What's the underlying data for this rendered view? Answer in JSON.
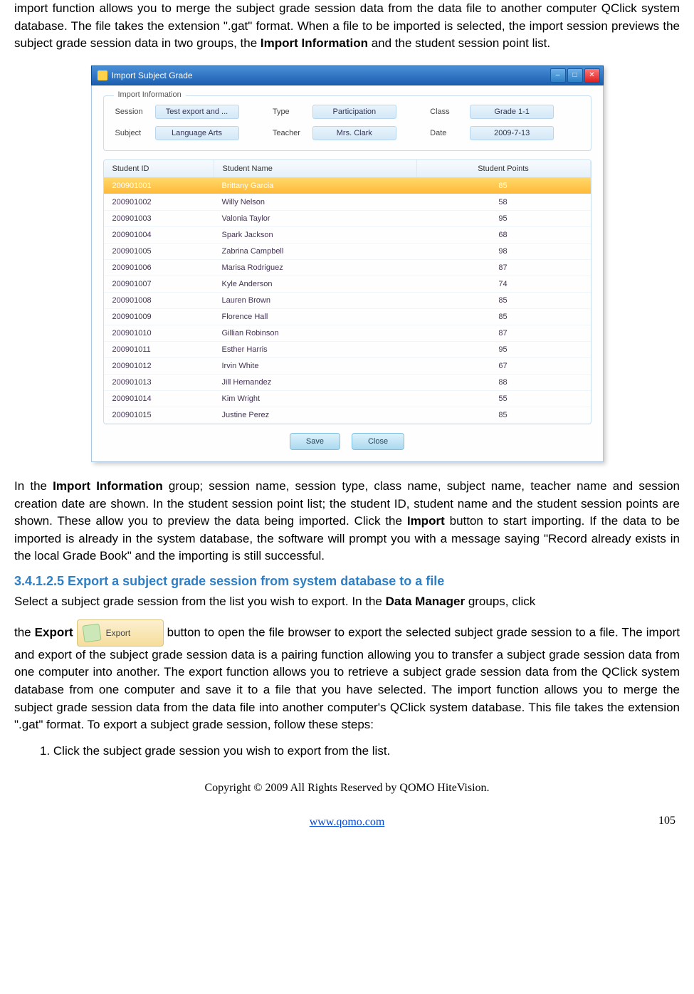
{
  "para1_part1": "import function allows you to merge the subject grade session data from the data file to another computer QClick system database. The file takes the extension \".gat\" format. When a file to be imported is selected, the import session previews the subject grade session data in two groups, the ",
  "para1_bold": "Import Information",
  "para1_part2": " and the student session point list.",
  "dialog": {
    "title": "Import Subject Grade",
    "legend": "Import Information",
    "labels": {
      "session": "Session",
      "type": "Type",
      "class": "Class",
      "subject": "Subject",
      "teacher": "Teacher",
      "date": "Date"
    },
    "values": {
      "session": "Test export and ...",
      "type": "Participation",
      "class": "Grade 1-1",
      "subject": "Language Arts",
      "teacher": "Mrs. Clark",
      "date": "2009-7-13"
    },
    "headers": {
      "id": "Student ID",
      "name": "Student Name",
      "points": "Student Points"
    },
    "rows": [
      {
        "id": "200901001",
        "name": "Brittany Garcia",
        "pts": "85",
        "sel": true
      },
      {
        "id": "200901002",
        "name": "Willy Nelson",
        "pts": "58"
      },
      {
        "id": "200901003",
        "name": "Valonia Taylor",
        "pts": "95"
      },
      {
        "id": "200901004",
        "name": "Spark Jackson",
        "pts": "68"
      },
      {
        "id": "200901005",
        "name": "Zabrina Campbell",
        "pts": "98"
      },
      {
        "id": "200901006",
        "name": "Marisa Rodriguez",
        "pts": "87"
      },
      {
        "id": "200901007",
        "name": "Kyle Anderson",
        "pts": "74"
      },
      {
        "id": "200901008",
        "name": "Lauren Brown",
        "pts": "85"
      },
      {
        "id": "200901009",
        "name": "Florence Hall",
        "pts": "85"
      },
      {
        "id": "200901010",
        "name": "Gillian Robinson",
        "pts": "87"
      },
      {
        "id": "200901011",
        "name": "Esther Harris",
        "pts": "95"
      },
      {
        "id": "200901012",
        "name": "Irvin White",
        "pts": "67"
      },
      {
        "id": "200901013",
        "name": "Jill  Hernandez",
        "pts": "88"
      },
      {
        "id": "200901014",
        "name": "Kim Wright",
        "pts": "55"
      },
      {
        "id": "200901015",
        "name": "Justine Perez",
        "pts": "85"
      }
    ],
    "save": "Save",
    "close": "Close"
  },
  "para2_a": "In the ",
  "para2_b": "Import Information",
  "para2_c": " group; session name, session type, class name, subject name, teacher name and session creation date are shown. In the student session point list; the student ID, student name and the student session points are shown. These allow you to preview the data being imported. Click the ",
  "para2_d": "Import",
  "para2_e": " button to start importing. If the data to be imported is already in the system database, the software will prompt you with a message saying \"Record already exists in the local Grade Book\" and the importing is still successful.",
  "heading": "3.4.1.2.5  Export a subject grade session from system database to a file",
  "para3_a": "Select a subject grade session from the list you wish to export. In the ",
  "para3_b": "Data Manager",
  "para3_c": " groups, click",
  "para4_a": "the ",
  "para4_b": "Export",
  "export_label": "Export",
  "para4_c": " button to open the file browser to export the selected subject grade session to a file. The import and export of the subject grade session data is a pairing function allowing you to transfer a subject grade session data from one computer into another. The export function allows you to retrieve a subject grade session data from the QClick system database from one computer and save it to a file that you have selected. The import function allows you to merge the subject grade session data from the data file into another computer's QClick system database. This file takes the extension \".gat\" format. To export a subject grade session, follow these steps:",
  "step1": "1.   Click the subject grade session you wish to export from the list.",
  "copyright": "Copyright © 2009 All Rights Reserved by QOMO HiteVision.",
  "url": "www.qomo.com",
  "pagenum": "105"
}
